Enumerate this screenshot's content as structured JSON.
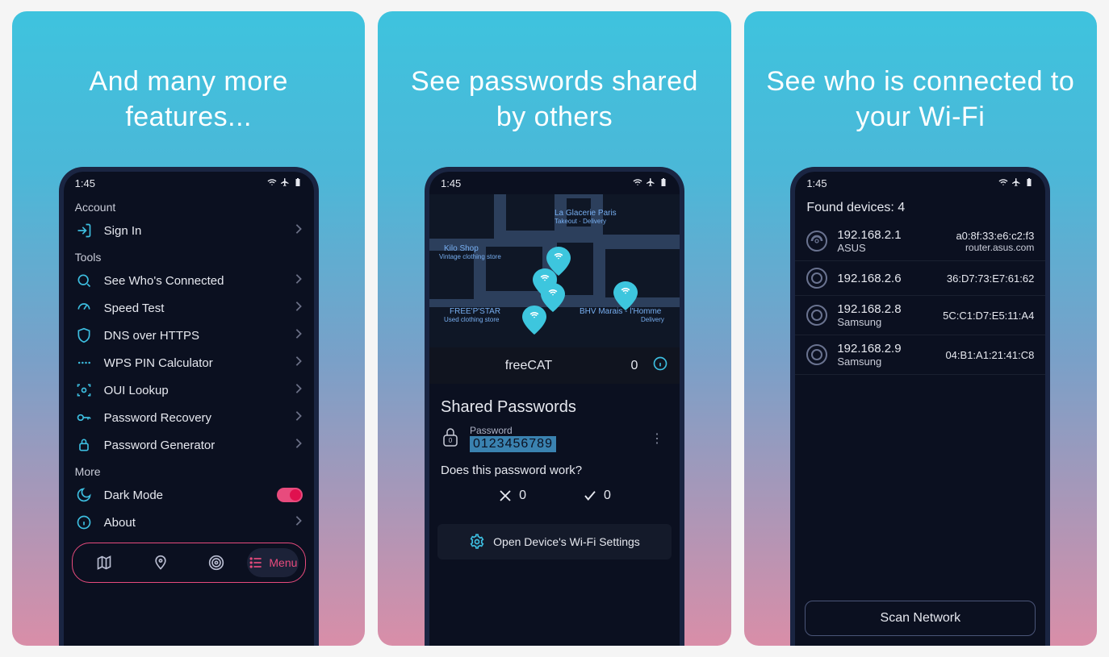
{
  "status_time": "1:45",
  "panels": [
    {
      "title": "And many more features..."
    },
    {
      "title": "See passwords shared by others"
    },
    {
      "title": "See who is connected to your Wi-Fi"
    }
  ],
  "features": {
    "account_label": "Account",
    "sign_in": "Sign In",
    "tools_label": "Tools",
    "items": [
      {
        "label": "See Who's Connected"
      },
      {
        "label": "Speed Test"
      },
      {
        "label": "DNS over HTTPS"
      },
      {
        "label": "WPS PIN Calculator"
      },
      {
        "label": "OUI Lookup"
      },
      {
        "label": "Password Recovery"
      },
      {
        "label": "Password Generator"
      }
    ],
    "more_label": "More",
    "dark_mode": "Dark Mode",
    "about": "About",
    "menu_tab": "Menu"
  },
  "map_labels": {
    "la_glacerie": "La Glacerie Paris",
    "la_glacerie_sub": "Takeout · Delivery",
    "kilo_shop": "Kilo Shop",
    "kilo_shop_sub": "Vintage clothing store",
    "freepstar": "FREE'P'STAR",
    "freepstar_sub": "Used clothing store",
    "bhv": "BHV Marais - l'Homme",
    "bhv_sub": "Delivery"
  },
  "shared": {
    "network_name": "freeCAT",
    "network_count": "0",
    "section_title": "Shared Passwords",
    "pwd_label": "Password",
    "pwd_value": "0123456789",
    "lock_badge": "0",
    "question": "Does this password work?",
    "no_count": "0",
    "yes_count": "0",
    "open_settings": "Open Device's Wi-Fi Settings"
  },
  "devices": {
    "found_label": "Found devices: 4",
    "list": [
      {
        "ip": "192.168.2.1",
        "name": "ASUS",
        "mac": "a0:8f:33:e6:c2:f3",
        "host": "router.asus.com",
        "type": "router"
      },
      {
        "ip": "192.168.2.6",
        "name": "",
        "mac": "36:D7:73:E7:61:62",
        "host": "",
        "type": "circle"
      },
      {
        "ip": "192.168.2.8",
        "name": "Samsung",
        "mac": "5C:C1:D7:E5:11:A4",
        "host": "",
        "type": "circle"
      },
      {
        "ip": "192.168.2.9",
        "name": "Samsung",
        "mac": "04:B1:A1:21:41:C8",
        "host": "",
        "type": "circle"
      }
    ],
    "scan_button": "Scan Network"
  }
}
